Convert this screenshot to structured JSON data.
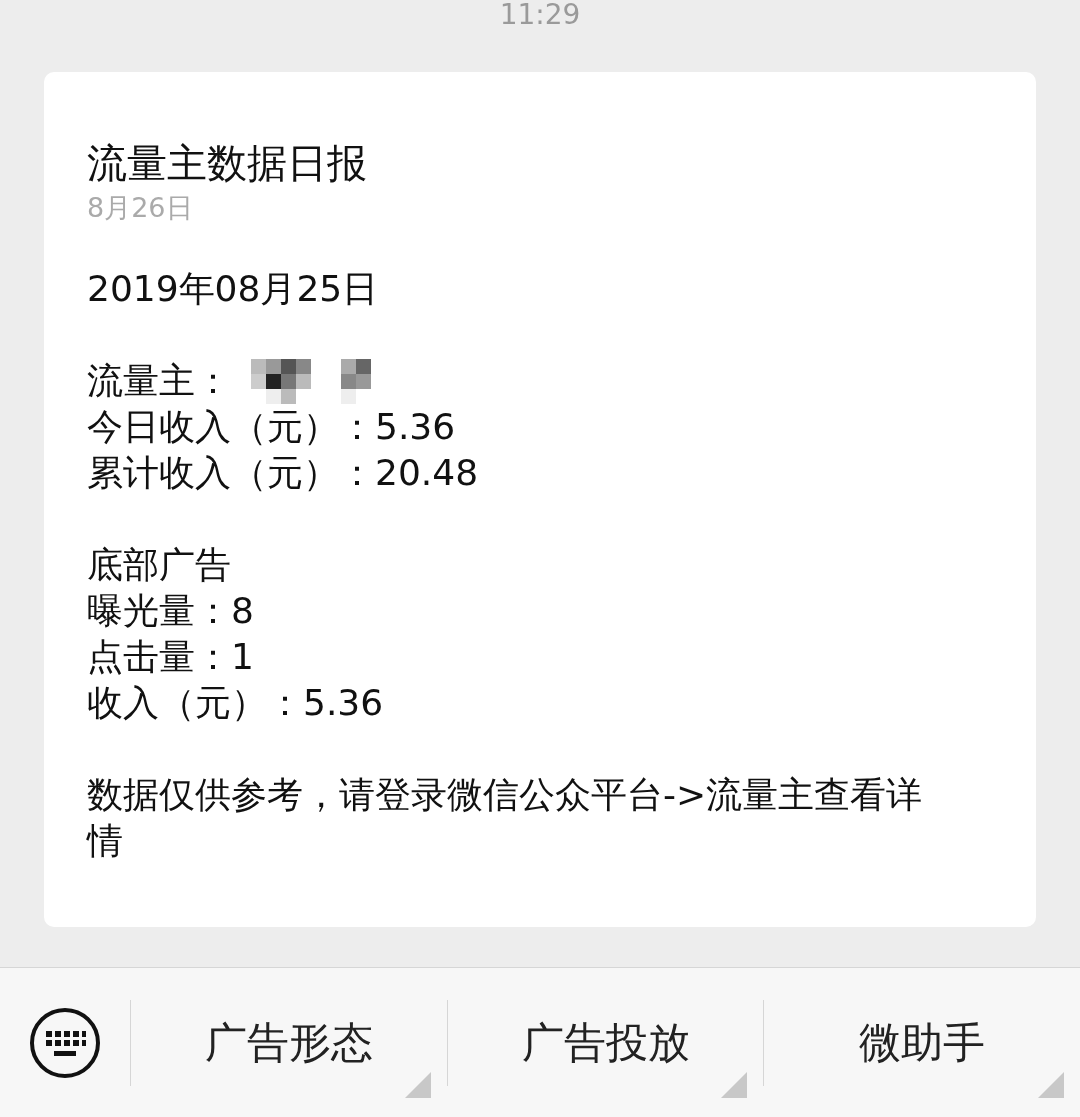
{
  "time": "11:29",
  "card": {
    "title": "流量主数据日报",
    "date": "8月26日",
    "sections": [
      [
        {
          "kind": "text",
          "text": "2019年08月25日"
        }
      ],
      [
        {
          "kind": "masked",
          "text": "流量主："
        },
        {
          "kind": "text",
          "text": "今日收入（元）：5.36"
        },
        {
          "kind": "text",
          "text": "累计收入（元）：20.48"
        }
      ],
      [
        {
          "kind": "text",
          "text": "底部广告"
        },
        {
          "kind": "text",
          "text": "曝光量：8"
        },
        {
          "kind": "text",
          "text": "点击量：1"
        },
        {
          "kind": "text",
          "text": "收入（元）：5.36"
        }
      ],
      [
        {
          "kind": "text",
          "text": "数据仅供参考，请登录微信公众平台->流量主查看详情"
        }
      ]
    ]
  },
  "menu": [
    {
      "label": "广告形态",
      "has_submenu": true
    },
    {
      "label": "广告投放",
      "has_submenu": true
    },
    {
      "label": "微助手",
      "has_submenu": true
    }
  ]
}
